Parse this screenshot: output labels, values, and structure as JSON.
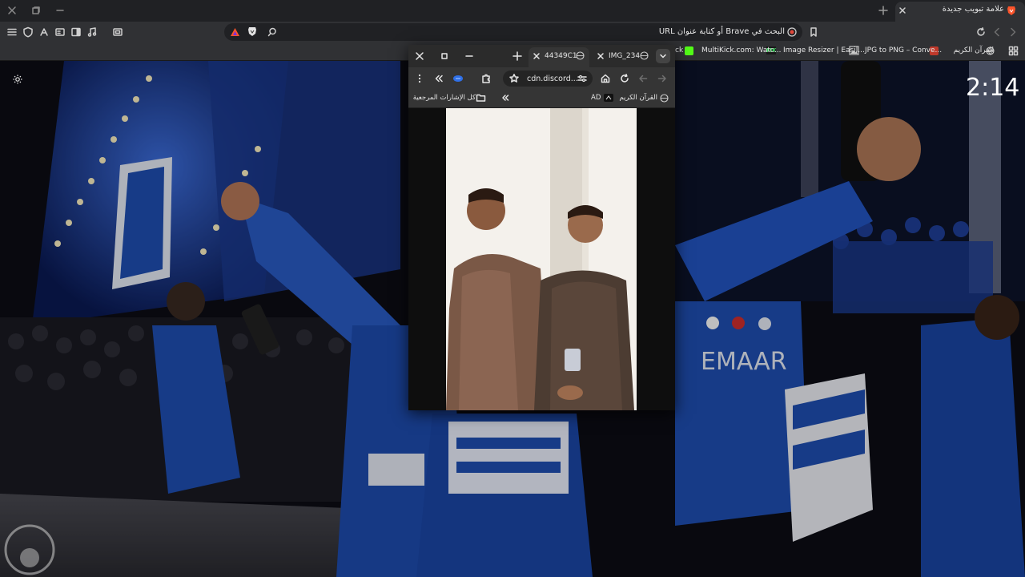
{
  "main_browser": {
    "active_tab": {
      "title": "علامة تبويب جديدة"
    },
    "omnibox": {
      "placeholder": "البحث في Brave أو كتابة عنوان URL"
    },
    "bookmarks": [
      {
        "label": "القرآن الكريم"
      },
      {
        "label": "JPG to PNG – Conve..."
      },
      {
        "label": "Image Resizer | Easil..."
      },
      {
        "label": "MultiKick.com: Watc..."
      },
      {
        "label": "ck"
      }
    ]
  },
  "popup": {
    "tabs": [
      {
        "title": "IMG_234"
      },
      {
        "title": "44349C1"
      }
    ],
    "address": "cdn.discord...",
    "bookmarks": [
      {
        "label": "القرآن الكريم"
      },
      {
        "label": "AD"
      }
    ],
    "all_bookmarks_label": "كل الإشارات المرجعية"
  },
  "video": {
    "countdown": "2:14",
    "jersey_text": "EMAAR"
  },
  "colors": {
    "brave_orange": "#fb542b",
    "chrome_dark": "#202124",
    "toolbar": "#303134",
    "hilal_blue": "#1f4fb5"
  },
  "icons": [
    "menu-icon",
    "shield-icon",
    "rewards-icon",
    "reader-icon",
    "sidebar-icon",
    "music-icon",
    "screenshot-icon",
    "brave-vpn-icon",
    "brave-shield-icon",
    "search-icon",
    "record-icon",
    "bookmark-icon",
    "reload-icon",
    "back-icon",
    "forward-icon",
    "grid-icon",
    "close-icon",
    "new-tab-icon",
    "minimize-icon",
    "maximize-icon",
    "settings-gear-icon"
  ]
}
